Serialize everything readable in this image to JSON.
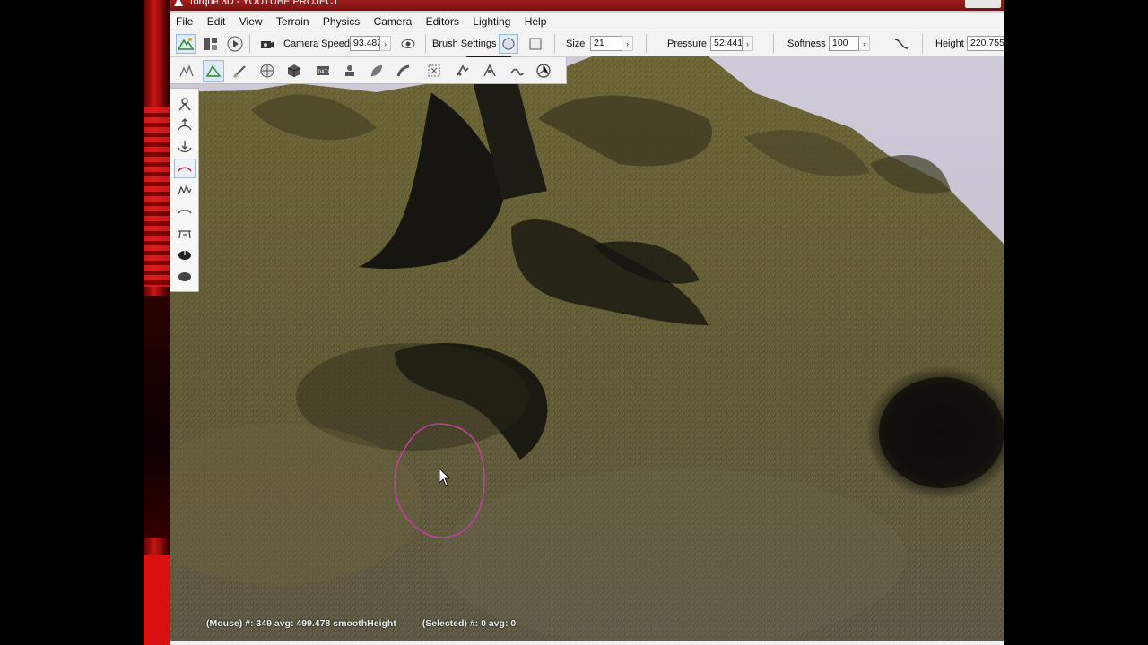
{
  "window": {
    "title": "Torque 3D - YOUTUBE PROJECT"
  },
  "menu": [
    "File",
    "Edit",
    "View",
    "Terrain",
    "Physics",
    "Camera",
    "Editors",
    "Lighting",
    "Help"
  ],
  "toolbar": {
    "camera_speed_label": "Camera Speed",
    "camera_speed_value": "93.487",
    "brush_settings_label": "Brush Settings",
    "size_label": "Size",
    "size_value": "21",
    "pressure_label": "Pressure",
    "pressure_value": "52.441",
    "softness_label": "Softness",
    "softness_value": "100",
    "height_label": "Height",
    "height_value": "220.755"
  },
  "status": {
    "mouse": "(Mouse) #: 349  avg: 499.478 smoothHeight",
    "selected": "(Selected) #: 0  avg: 0"
  },
  "colors": {
    "accent": "#9ab8d8",
    "brush_outline": "#c040a0",
    "terrain": "#5a5630"
  }
}
